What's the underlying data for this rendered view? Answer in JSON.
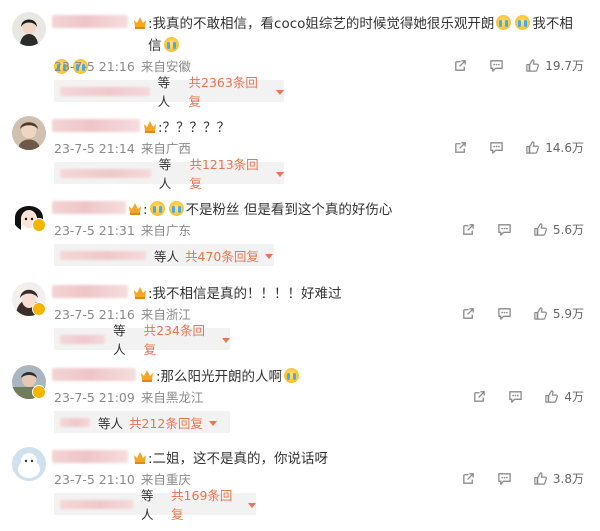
{
  "colors": {
    "accent": "#eb7350",
    "meta": "#8a8a8a",
    "reply_bg": "#f2f2f2"
  },
  "comments": [
    {
      "text_parts": [
        ":我真的不敢相信，看coco姐综艺的时候觉得她很乐观开朗",
        "我不相信"
      ],
      "emoji": "crying-face",
      "time": "23-7-5 21:16",
      "source": "来自安徽",
      "likes": "19.7万",
      "reply_etc": "等人",
      "reply_total": "共2363条回复"
    },
    {
      "text": ":？？？？？",
      "time": "23-7-5 21:14",
      "source": "来自广西",
      "likes": "14.6万",
      "reply_etc": "等人",
      "reply_total": "共1213条回复"
    },
    {
      "text": "不是粉丝  但是看到这个真的好伤心",
      "emoji": "crying-face",
      "time": "23-7-5 21:31",
      "source": "来自广东",
      "likes": "5.6万",
      "reply_etc": "等人",
      "reply_total": "共470条回复"
    },
    {
      "text": ":我不相信是真的！！！！好难过",
      "time": "23-7-5 21:16",
      "source": "来自浙江",
      "likes": "5.9万",
      "reply_etc": "等人",
      "reply_total": "共234条回复"
    },
    {
      "text": ":那么阳光开朗的人啊",
      "emoji": "crying-face",
      "time": "23-7-5 21:09",
      "source": "来自黑龙江",
      "likes": "4万",
      "reply_etc": "等人",
      "reply_total": "共212条回复"
    },
    {
      "text": ":二姐，这不是真的，你说话呀",
      "time": "23-7-5 21:10",
      "source": "来自重庆",
      "likes": "3.8万",
      "reply_etc": "等人",
      "reply_total": "共169条回复"
    }
  ]
}
